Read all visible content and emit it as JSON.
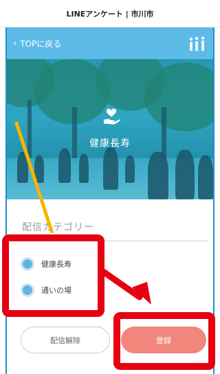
{
  "window": {
    "title": "LINEアンケート | 市川市"
  },
  "navbar": {
    "back_label": "TOPに戻る",
    "back_icon": "chevron-left-icon",
    "logo_icon": "ichikawa-logo-icon"
  },
  "hero": {
    "title": "健康長寿",
    "icon": "heart-hand-icon"
  },
  "form": {
    "section_label": "配信カテゴリー",
    "options": [
      {
        "label": "健康長寿",
        "selected": true
      },
      {
        "label": "通いの場",
        "selected": true
      }
    ]
  },
  "buttons": {
    "unsubscribe": "配信解除",
    "register": "登録"
  },
  "colors": {
    "nav_bg": "#5dbbe7",
    "radio": "#63b3e0",
    "register_btn": "#f2867c",
    "annotation": "#e60012",
    "annotation_line": "#f7b500"
  }
}
